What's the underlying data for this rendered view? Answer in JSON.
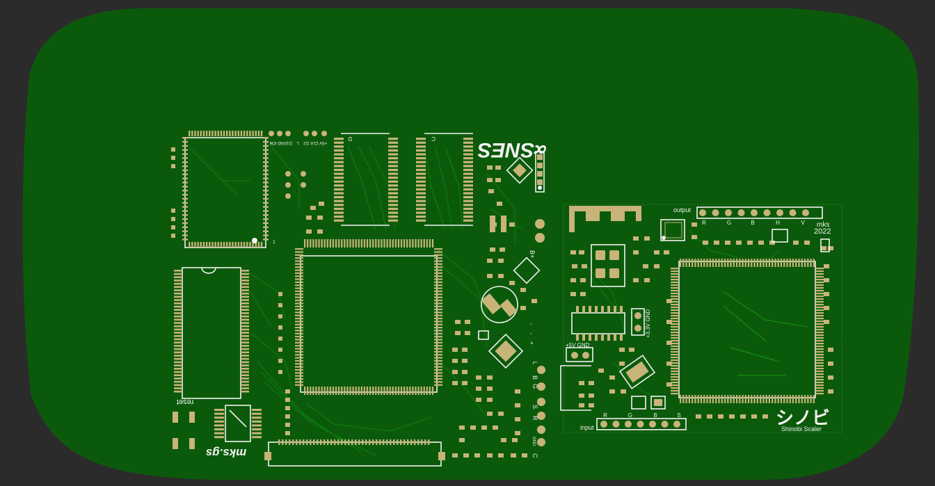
{
  "canvas": {
    "background": "#2b2b2b",
    "board_color": "#0b5a0b",
    "pad_color": "#c8b479",
    "silkscreen_color": "#f2f2f2",
    "trace_color": "#0e7a0e"
  },
  "board_left": {
    "logo": "∝SNES",
    "maker_mark": "mks.gs",
    "labels": {
      "reset": "reset",
      "gnd_io6": "GND IO6",
      "p5v_clk": "+5V CLK",
      "d1": "D1",
      "l": "L",
      "d2": "D2",
      "chip_mark_1": "1",
      "chip_d_left": "D",
      "chip_d_right": "C",
      "b_plus": "B+",
      "side_minus1": "-",
      "side_minus2": "-",
      "side_plus": "+",
      "side_l": "L",
      "side_g": "G",
      "side_b": "B",
      "side_s": "S",
      "side_r": "R",
      "side_gnd": "GND",
      "side_c": "C"
    }
  },
  "board_right": {
    "output_label": "output",
    "output_pins": [
      "R",
      "G",
      "B",
      "H",
      "V"
    ],
    "maker": "mks",
    "year": "2022",
    "power_5v": "+5V GND",
    "power_3v3": "+3.3V GND",
    "input_label": "input",
    "input_pins": [
      "R",
      "G",
      "B",
      "S"
    ],
    "logo_jp": "シノビ",
    "logo_en": "Shinobi Scaler"
  }
}
